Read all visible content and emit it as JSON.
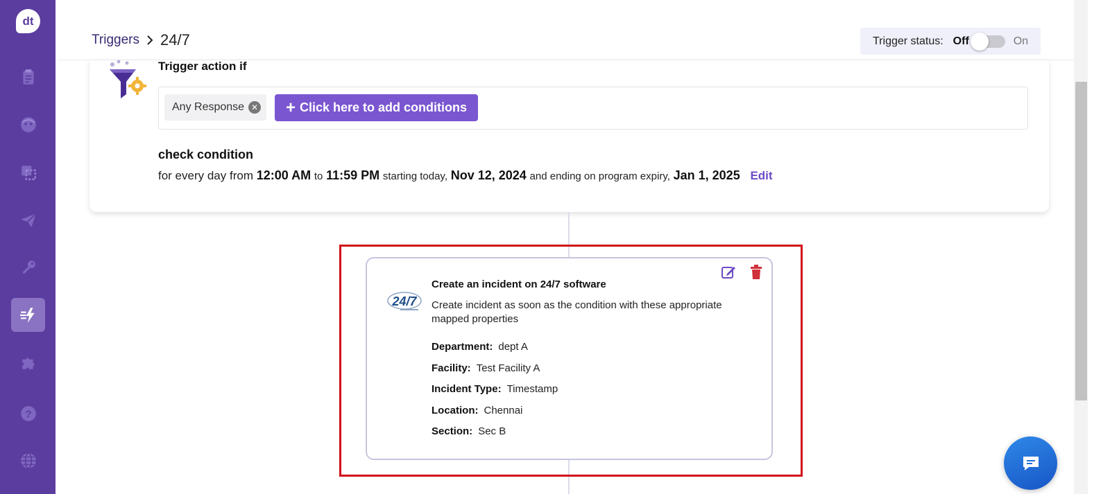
{
  "app": {
    "logo_text": "dt"
  },
  "sidebar": {
    "items": [
      {
        "icon": "clipboard-icon"
      },
      {
        "icon": "smiley-icon"
      },
      {
        "icon": "screens-icon"
      },
      {
        "icon": "paper-plane-icon"
      },
      {
        "icon": "key-icon"
      },
      {
        "icon": "lightning-icon",
        "active": true
      },
      {
        "icon": "puzzle-icon"
      },
      {
        "icon": "help-icon"
      },
      {
        "icon": "globe-icon"
      }
    ]
  },
  "breadcrumb": {
    "parent": "Triggers",
    "current": "24/7"
  },
  "status": {
    "label": "Trigger status:",
    "off": "Off",
    "on": "On",
    "enabled": false
  },
  "trigger": {
    "title": "Trigger action if",
    "chip_label": "Any Response",
    "add_conditions_label": "Click here to add conditions",
    "add_plus": "+",
    "check_title": "check condition",
    "schedule": {
      "prefix": "for every day from",
      "start_time": "12:00 AM",
      "to": "to",
      "end_time": "11:59 PM",
      "starting": "starting today,",
      "start_date": "Nov 12, 2024",
      "ending": "and ending on program expiry,",
      "end_date": "Jan 1, 2025",
      "edit": "Edit"
    }
  },
  "action": {
    "logo_text": "24/7",
    "title": "Create an incident on 24/7 software",
    "description": "Create incident as soon as the condition with these appropriate mapped properties",
    "properties": [
      {
        "label": "Department:",
        "value": "dept A"
      },
      {
        "label": "Facility:",
        "value": "Test Facility A"
      },
      {
        "label": "Incident Type:",
        "value": "Timestamp"
      },
      {
        "label": "Location:",
        "value": "Chennai"
      },
      {
        "label": "Section:",
        "value": "Sec B"
      }
    ]
  },
  "colors": {
    "sidebar": "#5b3d9f",
    "accent": "#7a56d1",
    "highlight": "#d10f1b",
    "delete": "#d0313a",
    "chat": "#1f6fdc"
  }
}
